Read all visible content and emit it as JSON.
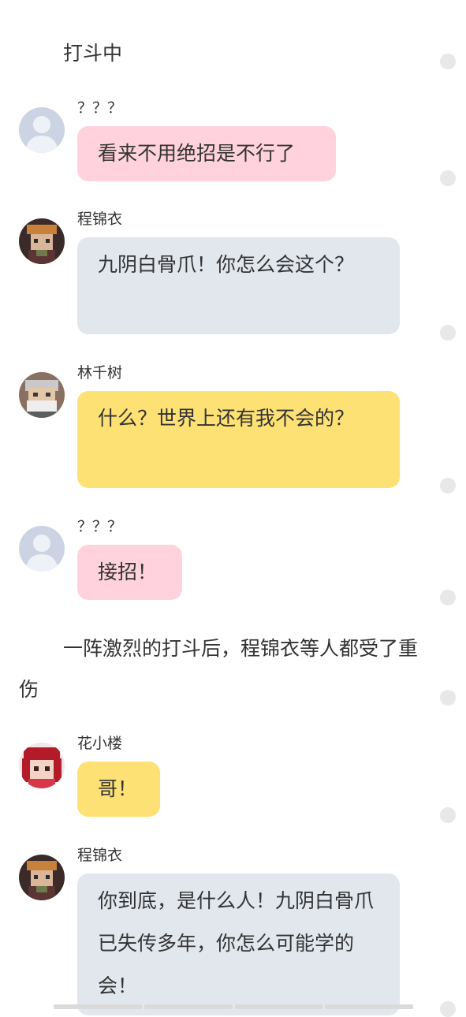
{
  "narration_1": "打斗中",
  "narration_2": "一阵激烈的打斗后，程锦衣等人都受了重伤",
  "messages": [
    {
      "name": "？？？",
      "text": "看来不用绝招是不行了",
      "color": "#ffd2dd"
    },
    {
      "name": "程锦衣",
      "text": "九阴白骨爪！你怎么会这个？",
      "color": "#e2e7ee"
    },
    {
      "name": "林千树",
      "text": "什么？世界上还有我不会的？",
      "color": "#fde174"
    },
    {
      "name": "？？？",
      "text": "接招！",
      "color": "#ffd2dd"
    },
    {
      "name": "花小楼",
      "text": "哥！",
      "color": "#fde174"
    },
    {
      "name": "程锦衣",
      "text": "你到底，是什么人！九阴白骨爪已失传多年，你怎么可能学的会！",
      "color": "#e2e7ee"
    }
  ]
}
